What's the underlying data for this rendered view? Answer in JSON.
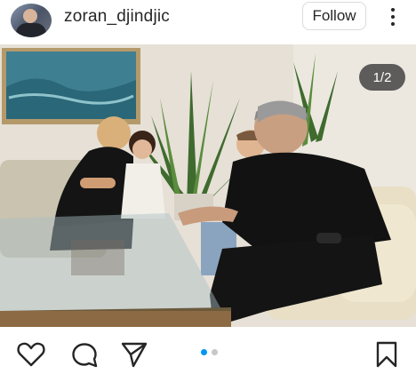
{
  "post": {
    "username": "zoran_djindjic",
    "follow_label": "Follow",
    "image_counter": "1/2",
    "carousel": {
      "total": 2,
      "active_index": 0
    }
  },
  "icons": {
    "like": "heart-icon",
    "comment": "comment-icon",
    "share": "send-icon",
    "save": "bookmark-icon",
    "more": "more-vertical-icon"
  },
  "colors": {
    "text": "#262626",
    "border": "#dbdbdb",
    "active_dot": "#0095f6",
    "inactive_dot": "#c7c7c7"
  }
}
